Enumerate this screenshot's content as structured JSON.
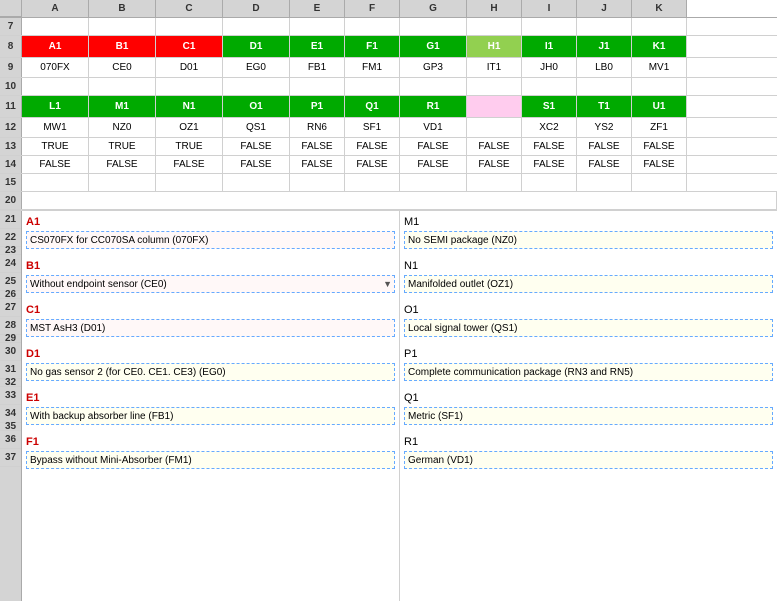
{
  "columns": [
    "",
    "A",
    "B",
    "C",
    "D",
    "E",
    "F",
    "G",
    "H",
    "I",
    "J",
    "K"
  ],
  "rows": {
    "row7": {
      "num": "7",
      "cells": []
    },
    "row8": {
      "num": "8",
      "cells": [
        {
          "text": "A1",
          "col": "a",
          "bg": "red",
          "color": "white",
          "bold": true
        },
        {
          "text": "B1",
          "col": "b",
          "bg": "red",
          "color": "white",
          "bold": true
        },
        {
          "text": "C1",
          "col": "c",
          "bg": "red",
          "color": "white",
          "bold": true
        },
        {
          "text": "D1",
          "col": "d",
          "bg": "green",
          "color": "white",
          "bold": true
        },
        {
          "text": "E1",
          "col": "e",
          "bg": "green",
          "color": "white",
          "bold": true
        },
        {
          "text": "F1",
          "col": "f",
          "bg": "green",
          "color": "white",
          "bold": true
        },
        {
          "text": "G1",
          "col": "g",
          "bg": "green",
          "color": "white",
          "bold": true
        },
        {
          "text": "H1",
          "col": "h",
          "bg": "lt-green",
          "color": "white",
          "bold": true
        },
        {
          "text": "I1",
          "col": "i",
          "bg": "green",
          "color": "white",
          "bold": true
        },
        {
          "text": "J1",
          "col": "j",
          "bg": "green",
          "color": "white",
          "bold": true
        },
        {
          "text": "K1",
          "col": "k",
          "bg": "green",
          "color": "white",
          "bold": true
        }
      ]
    },
    "row9": {
      "num": "9",
      "cells": [
        {
          "text": "070FX",
          "col": "a"
        },
        {
          "text": "CE0",
          "col": "b"
        },
        {
          "text": "D01",
          "col": "c"
        },
        {
          "text": "EG0",
          "col": "d"
        },
        {
          "text": "FB1",
          "col": "e"
        },
        {
          "text": "FM1",
          "col": "f"
        },
        {
          "text": "GP3",
          "col": "g"
        },
        {
          "text": "IT1",
          "col": "h"
        },
        {
          "text": "JH0",
          "col": "i"
        },
        {
          "text": "LB0",
          "col": "j"
        },
        {
          "text": "MV1",
          "col": "k"
        }
      ]
    },
    "row10": {
      "num": "10",
      "cells": []
    },
    "row11": {
      "num": "11",
      "cells": [
        {
          "text": "L1",
          "col": "a",
          "bg": "green",
          "color": "white",
          "bold": true
        },
        {
          "text": "M1",
          "col": "b",
          "bg": "green",
          "color": "white",
          "bold": true
        },
        {
          "text": "N1",
          "col": "c",
          "bg": "green",
          "color": "white",
          "bold": true
        },
        {
          "text": "O1",
          "col": "d",
          "bg": "green",
          "color": "white",
          "bold": true
        },
        {
          "text": "P1",
          "col": "e",
          "bg": "green",
          "color": "white",
          "bold": true
        },
        {
          "text": "Q1",
          "col": "f",
          "bg": "green",
          "color": "white",
          "bold": true
        },
        {
          "text": "R1",
          "col": "g",
          "bg": "green",
          "color": "white",
          "bold": true
        },
        {
          "text": "",
          "col": "h",
          "bg": "pink"
        },
        {
          "text": "S1",
          "col": "i",
          "bg": "green",
          "color": "white",
          "bold": true
        },
        {
          "text": "T1",
          "col": "j",
          "bg": "green",
          "color": "white",
          "bold": true
        },
        {
          "text": "U1",
          "col": "k",
          "bg": "green",
          "color": "white",
          "bold": true
        }
      ]
    },
    "row12": {
      "num": "12",
      "cells": [
        {
          "text": "MW1",
          "col": "a"
        },
        {
          "text": "NZ0",
          "col": "b"
        },
        {
          "text": "OZ1",
          "col": "c"
        },
        {
          "text": "QS1",
          "col": "d"
        },
        {
          "text": "RN6",
          "col": "e"
        },
        {
          "text": "SF1",
          "col": "f"
        },
        {
          "text": "VD1",
          "col": "g"
        },
        {
          "text": "",
          "col": "h"
        },
        {
          "text": "XC2",
          "col": "i"
        },
        {
          "text": "YS2",
          "col": "j"
        },
        {
          "text": "ZF1",
          "col": "k"
        }
      ]
    },
    "row13": {
      "num": "13",
      "cells": [
        {
          "text": "TRUE",
          "col": "a"
        },
        {
          "text": "TRUE",
          "col": "b"
        },
        {
          "text": "TRUE",
          "col": "c"
        },
        {
          "text": "FALSE",
          "col": "d"
        },
        {
          "text": "FALSE",
          "col": "e"
        },
        {
          "text": "FALSE",
          "col": "f"
        },
        {
          "text": "FALSE",
          "col": "g"
        },
        {
          "text": "FALSE",
          "col": "h"
        },
        {
          "text": "FALSE",
          "col": "i"
        },
        {
          "text": "FALSE",
          "col": "j"
        },
        {
          "text": "FALSE",
          "col": "k"
        }
      ]
    },
    "row14": {
      "num": "14",
      "cells": [
        {
          "text": "FALSE",
          "col": "a"
        },
        {
          "text": "FALSE",
          "col": "b"
        },
        {
          "text": "FALSE",
          "col": "c"
        },
        {
          "text": "FALSE",
          "col": "d"
        },
        {
          "text": "FALSE",
          "col": "e"
        },
        {
          "text": "FALSE",
          "col": "f"
        },
        {
          "text": "FALSE",
          "col": "g"
        },
        {
          "text": "FALSE",
          "col": "h"
        },
        {
          "text": "FALSE",
          "col": "i"
        },
        {
          "text": "FALSE",
          "col": "j"
        },
        {
          "text": "FALSE",
          "col": "k"
        }
      ]
    }
  },
  "sections_left": [
    {
      "label": "A1",
      "desc": "CS070FX for CC070SA column (070FX)",
      "bg": "pink"
    },
    {
      "label": "B1",
      "desc": "Without endpoint sensor (CE0)",
      "bg": "pink",
      "dropdown": true
    },
    {
      "label": "C1",
      "desc": "MST AsH3 (D01)",
      "bg": "pink"
    },
    {
      "label": "D1",
      "desc": "No gas sensor 2 (for CE0. CE1. CE3) (EG0)",
      "bg": "yellow"
    },
    {
      "label": "E1",
      "desc": "With backup absorber line (FB1)",
      "bg": "yellow"
    },
    {
      "label": "F1",
      "desc": "Bypass without Mini-Absorber (FM1)",
      "bg": "yellow"
    }
  ],
  "sections_right": [
    {
      "label": "M1",
      "desc": "No SEMI package (NZ0)",
      "bg": "yellow"
    },
    {
      "label": "N1",
      "desc": "Manifolded outlet (OZ1)",
      "bg": "yellow"
    },
    {
      "label": "O1",
      "desc": "Local signal tower (QS1)",
      "bg": "yellow"
    },
    {
      "label": "P1",
      "desc": "Complete communication package (RN3 and RN5)",
      "bg": "yellow"
    },
    {
      "label": "Q1",
      "desc": "Metric (SF1)",
      "bg": "yellow"
    },
    {
      "label": "R1",
      "desc": "German (VD1)",
      "bg": "yellow"
    }
  ],
  "row_numbers": [
    "7",
    "8",
    "9",
    "10",
    "11",
    "12",
    "13",
    "14",
    "15",
    "20",
    "21",
    "22",
    "23",
    "24",
    "25",
    "26",
    "27",
    "28",
    "29",
    "30",
    "31",
    "32",
    "33",
    "34",
    "35",
    "36",
    "37"
  ]
}
